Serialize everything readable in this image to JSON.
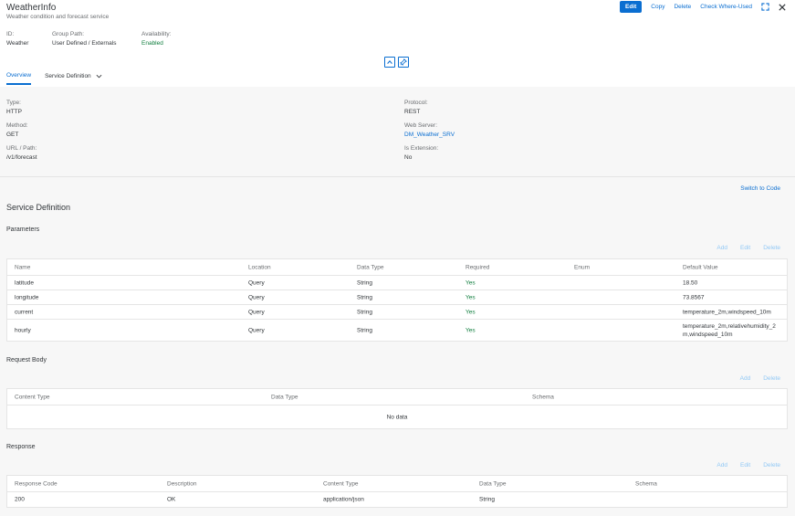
{
  "header": {
    "title": "WeatherInfo",
    "subtitle": "Weather condition and forecast service",
    "actions": {
      "edit": "Edit",
      "copy": "Copy",
      "delete": "Delete",
      "check": "Check Where-Used"
    },
    "fields": [
      {
        "label": "ID:",
        "value": "Weather"
      },
      {
        "label": "Group Path:",
        "value": "User Defined / Externals"
      },
      {
        "label": "Availability:",
        "value": "Enabled"
      }
    ]
  },
  "tabs": {
    "overview": "Overview",
    "service_definition": "Service Definition"
  },
  "general": {
    "type_label": "Type:",
    "type_value": "HTTP",
    "method_label": "Method:",
    "method_value": "GET",
    "url_label": "URL / Path:",
    "url_value": "/v1/forecast",
    "protocol_label": "Protocol:",
    "protocol_value": "REST",
    "server_label": "Web Server:",
    "server_value": "DM_Weather_SRV",
    "ext_label": "Is Extension:",
    "ext_value": "No"
  },
  "service_def": {
    "switch_label": "Switch to Code",
    "title": "Service Definition",
    "parameters": {
      "title": "Parameters",
      "actions": {
        "add": "Add",
        "edit": "Edit",
        "delete": "Delete"
      },
      "columns": [
        "Name",
        "Location",
        "Data Type",
        "Required",
        "Enum",
        "Default Value"
      ],
      "rows": [
        [
          "latitude",
          "Query",
          "String",
          "Yes",
          "",
          "18.50"
        ],
        [
          "longitude",
          "Query",
          "String",
          "Yes",
          "",
          "73.8567"
        ],
        [
          "current",
          "Query",
          "String",
          "Yes",
          "",
          "temperature_2m,windspeed_10m"
        ],
        [
          "hourly",
          "Query",
          "String",
          "Yes",
          "",
          "temperature_2m,relativehumidity_2",
          "m,windspeed_10m"
        ]
      ]
    },
    "request_body": {
      "title": "Request Body",
      "actions": {
        "add": "Add",
        "delete": "Delete"
      },
      "columns": [
        "Content Type",
        "Data Type",
        "Schema"
      ],
      "empty": "No data"
    },
    "response": {
      "title": "Response",
      "actions": {
        "add": "Add",
        "edit": "Edit",
        "delete": "Delete"
      },
      "columns": [
        "Response Code",
        "Description",
        "Content Type",
        "Data Type",
        "Schema"
      ],
      "rows": [
        [
          "200",
          "OK",
          "application/json",
          "String",
          ""
        ]
      ]
    }
  },
  "colors": {
    "accent": "#0a6ed1",
    "positive": "#107e3e",
    "disabled": "#91c8f6"
  },
  "icons": [
    "expand-icon",
    "close-icon",
    "collapse-header-icon",
    "pin-header-icon",
    "chevron-down-icon"
  ]
}
